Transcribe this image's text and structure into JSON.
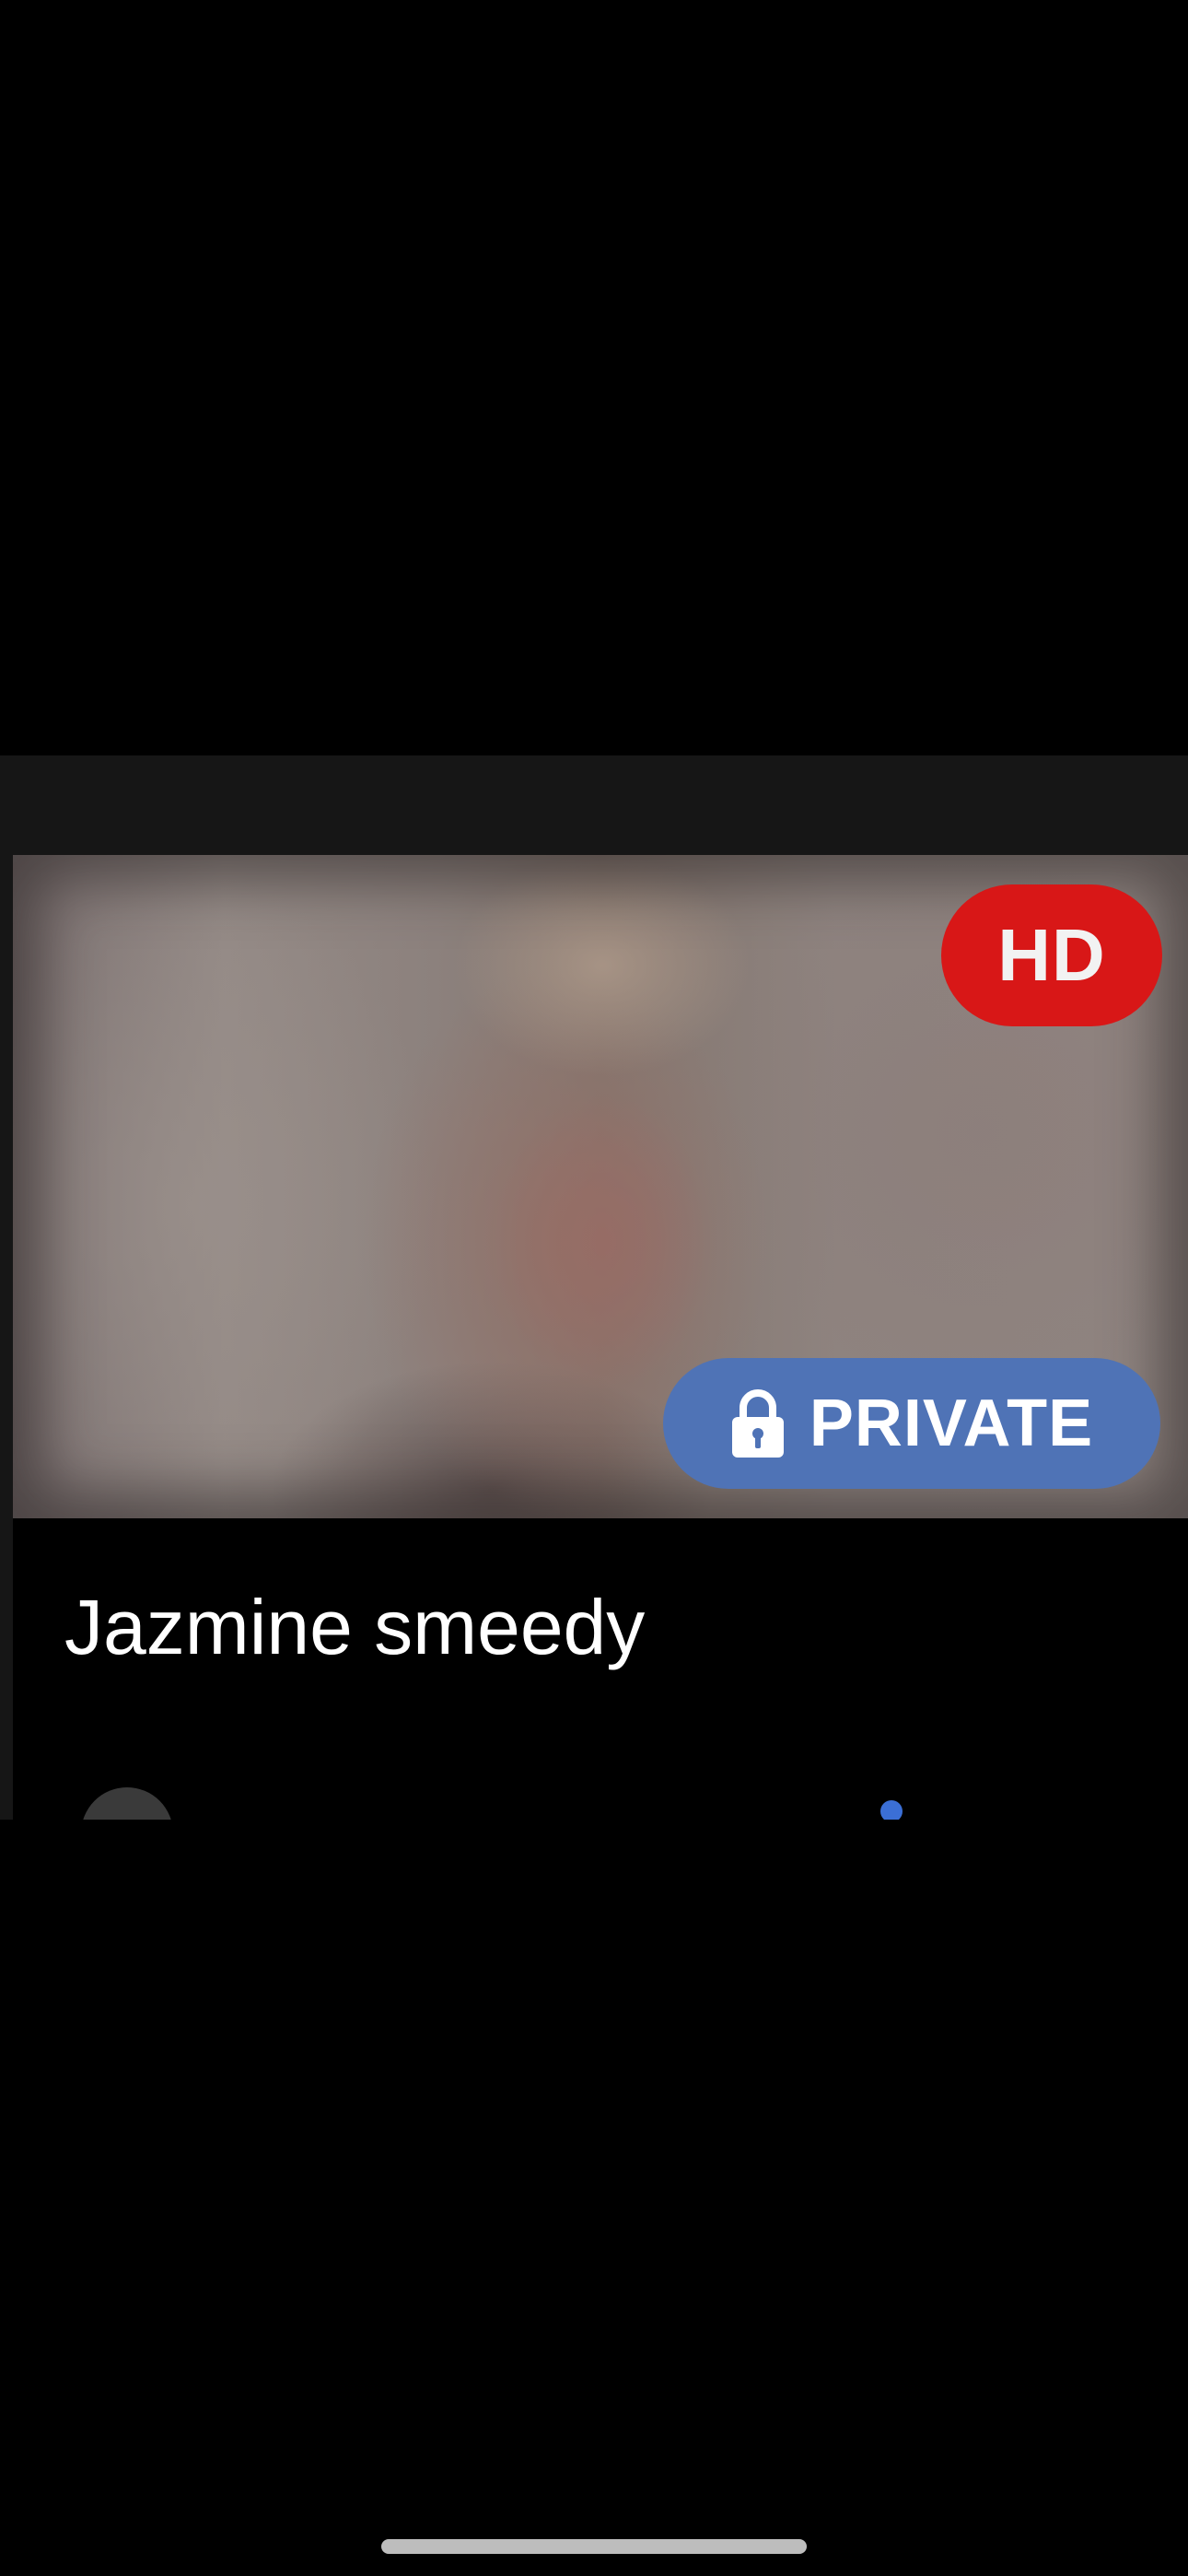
{
  "video_card": {
    "title": "Jazmine smeedy",
    "badges": {
      "hd": "HD",
      "private": "PRIVATE"
    },
    "icons": {
      "private": "lock-icon"
    }
  },
  "colors": {
    "hd_badge": "#d81717",
    "private_badge": "#4f73b6",
    "background": "#000000",
    "card_frame": "#161616",
    "status_dot": "#3b6fd6"
  }
}
